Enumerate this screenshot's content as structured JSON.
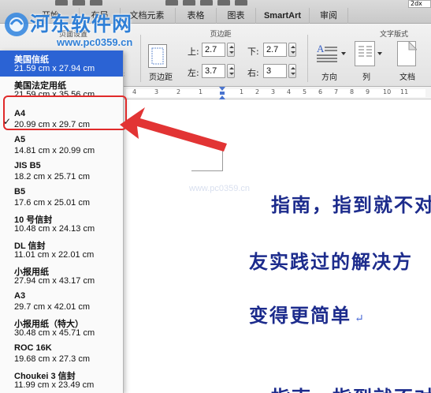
{
  "ribbon": {
    "tabs": [
      "开始",
      "布局",
      "文档元素",
      "表格",
      "图表",
      "SmartArt",
      "审阅"
    ],
    "groups": {
      "page_setup": "页面设置",
      "margins": "页边距",
      "text_layout": "文字版式"
    },
    "partial_label": "符",
    "margins_button": "页边距",
    "margins": {
      "top_label": "上:",
      "top_value": "2.7",
      "bottom_label": "下:",
      "bottom_value": "2.7",
      "left_label": "左:",
      "left_value": "3.7",
      "right_label": "右:",
      "right_value": "3"
    },
    "direction_button": "方向",
    "columns_button": "列",
    "document_button": "文档",
    "zoom_partial": "2dx"
  },
  "page_sizes": [
    {
      "name": "美国信纸",
      "size": "21.59 cm x 27.94 cm",
      "selected": true,
      "checked": false
    },
    {
      "name": "美国法定用纸",
      "size": "21.59 cm x 35.56 cm",
      "selected": false,
      "checked": false
    },
    {
      "name": "A4",
      "size": "20.99 cm x 29.7 cm",
      "selected": false,
      "checked": true
    },
    {
      "name": "A5",
      "size": "14.81 cm x 20.99 cm",
      "selected": false,
      "checked": false
    },
    {
      "name": "JIS B5",
      "size": "18.2 cm x 25.71 cm",
      "selected": false,
      "checked": false
    },
    {
      "name": "B5",
      "size": "17.6 cm x 25.01 cm",
      "selected": false,
      "checked": false
    },
    {
      "name": "10 号信封",
      "size": "10.48 cm x 24.13 cm",
      "selected": false,
      "checked": false
    },
    {
      "name": "DL 信封",
      "size": "11.01 cm x 22.01 cm",
      "selected": false,
      "checked": false
    },
    {
      "name": "小报用纸",
      "size": "27.94 cm x 43.17 cm",
      "selected": false,
      "checked": false
    },
    {
      "name": "A3",
      "size": "29.7 cm x 42.01 cm",
      "selected": false,
      "checked": false
    },
    {
      "name": "小报用纸（特大）",
      "size": "30.48 cm x 45.71 cm",
      "selected": false,
      "checked": false
    },
    {
      "name": "ROC 16K",
      "size": "19.68 cm x 27.3 cm",
      "selected": false,
      "checked": false
    },
    {
      "name": "Choukei 3 信封",
      "size": "11.99 cm x 23.49 cm",
      "selected": false,
      "checked": false
    }
  ],
  "checkmark": "✓",
  "ruler_numbers": [
    "4",
    "3",
    "2",
    "1",
    "1",
    "2",
    "3",
    "4",
    "5",
    "6",
    "7",
    "8",
    "9",
    "10",
    "11"
  ],
  "document": {
    "lines": [
      "指南，指到就不对",
      "友实践过的解决方",
      "变得更简单",
      "指南，指到就不对"
    ],
    "paragraph_mark": "↵",
    "faint_watermark": "www.pc0359.cn"
  },
  "watermark": {
    "title": "河东软件网",
    "url": "www.pc0359.cn"
  },
  "colors": {
    "selection": "#2b63d4",
    "annotation": "#e02a2a",
    "doc_text": "#1c2b8c",
    "watermark": "#2f7fd6"
  }
}
